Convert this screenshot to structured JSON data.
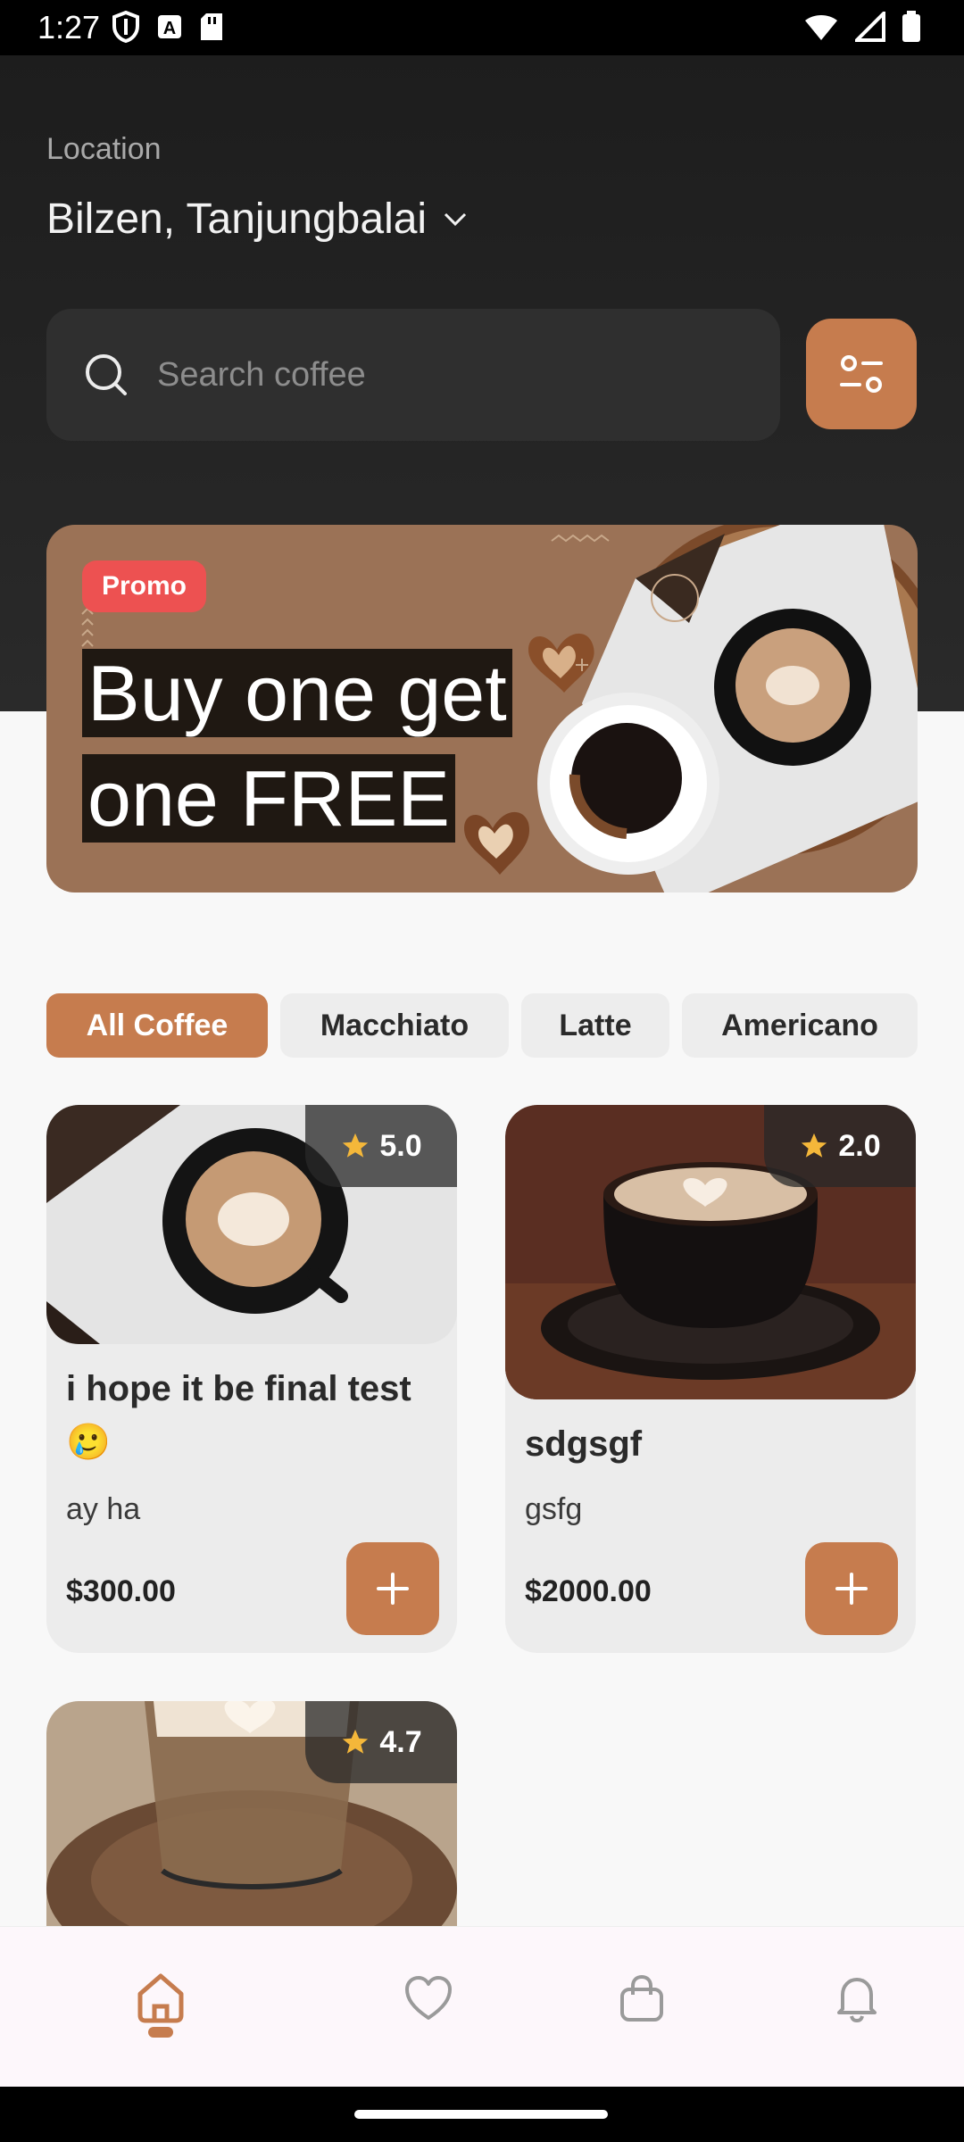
{
  "status_bar": {
    "time": "1:27"
  },
  "header": {
    "location_label": "Location",
    "location_value": "Bilzen, Tanjungbalai"
  },
  "search": {
    "placeholder": "Search coffee",
    "value": ""
  },
  "promo": {
    "badge": "Promo",
    "title_line1": "Buy one get",
    "title_line2": "one FREE"
  },
  "categories": [
    {
      "label": "All Coffee",
      "active": true
    },
    {
      "label": "Macchiato",
      "active": false
    },
    {
      "label": "Latte",
      "active": false
    },
    {
      "label": "Americano",
      "active": false
    }
  ],
  "products": [
    {
      "rating": "5.0",
      "name": "i hope it be final test 🥲",
      "desc": "ay ha",
      "price": "$300.00"
    },
    {
      "rating": "2.0",
      "name": "sdgsgf",
      "desc": "gsfg",
      "price": "$2000.00"
    },
    {
      "rating": "4.7",
      "name": "",
      "desc": "",
      "price": ""
    }
  ],
  "bottom_nav": [
    {
      "icon": "home-icon",
      "active": true
    },
    {
      "icon": "heart-icon",
      "active": false
    },
    {
      "icon": "bag-icon",
      "active": false
    },
    {
      "icon": "bell-icon",
      "active": false
    }
  ],
  "colors": {
    "accent": "#c67c4e",
    "promo_badge": "#ed5151",
    "dark": "#1d1d1d"
  }
}
